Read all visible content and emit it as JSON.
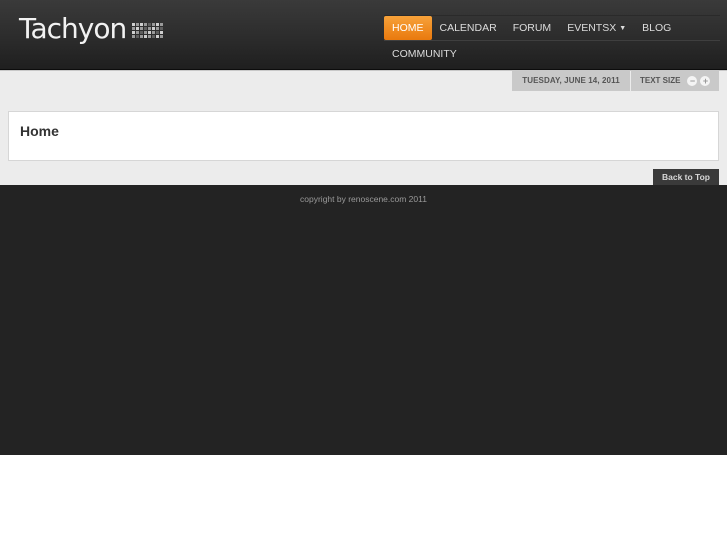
{
  "header": {
    "logo_text": "Tachyon",
    "nav": [
      {
        "label": "HOME",
        "active": true
      },
      {
        "label": "CALENDAR"
      },
      {
        "label": "FORUM"
      },
      {
        "label": "EVENTSX",
        "has_dropdown": true
      },
      {
        "label": "BLOG"
      },
      {
        "label": "COMMUNITY"
      }
    ]
  },
  "toolbar": {
    "date": "TUESDAY, JUNE 14, 2011",
    "text_size_label": "TEXT SIZE",
    "decrease_icon": "minus-icon",
    "increase_icon": "plus-icon"
  },
  "main": {
    "title": "Home"
  },
  "footer": {
    "back_to_top": "Back to Top",
    "copyright": "copyright by renoscene.com 2011"
  },
  "colors": {
    "accent": "#f28a1f",
    "header_bg": "#2c2c2c",
    "footer_bg": "#232323",
    "band_bg": "#ececec"
  }
}
